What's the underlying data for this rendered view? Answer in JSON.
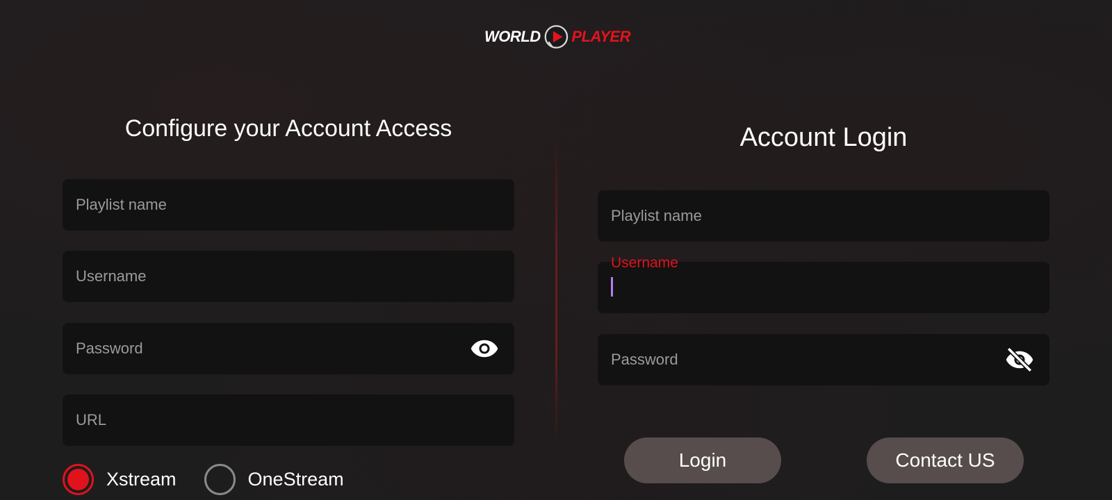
{
  "logo": {
    "text_left": "WORLD",
    "text_right": "PLAYER"
  },
  "left_panel": {
    "title": "Configure your Account Access",
    "fields": {
      "playlist_placeholder": "Playlist name",
      "username_placeholder": "Username",
      "password_placeholder": "Password",
      "url_placeholder": "URL"
    },
    "stream_types": [
      {
        "label": "Xstream",
        "selected": true
      },
      {
        "label": "OneStream",
        "selected": false
      }
    ]
  },
  "right_panel": {
    "title": "Account Login",
    "fields": {
      "playlist_placeholder": "Playlist name",
      "username_label": "Username",
      "username_value": "",
      "password_placeholder": "Password"
    },
    "buttons": {
      "login": "Login",
      "contact": "Contact US"
    }
  },
  "colors": {
    "accent": "#e0121c",
    "background": "#1e1d1e",
    "field": "#121212",
    "button": "#574d4d",
    "cursor": "#b47cf2"
  },
  "icons": {
    "left_password_toggle": "eye-icon",
    "right_password_toggle": "eye-off-icon"
  }
}
